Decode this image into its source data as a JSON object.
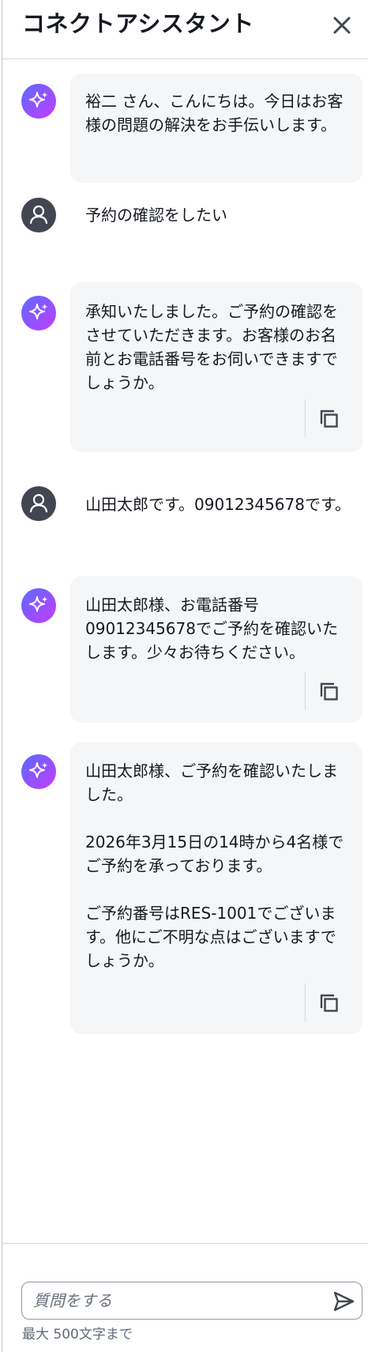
{
  "header": {
    "title": "コネクトアシスタント"
  },
  "messages": [
    {
      "role": "assistant",
      "text": "裕二 さん、こんにちは。今日はお客様の問題の解決をお手伝いします。",
      "copy": false
    },
    {
      "role": "user",
      "text": "予約の確認をしたい"
    },
    {
      "role": "assistant",
      "text": "承知いたしました。ご予約の確認をさせていただきます。お客様のお名前とお電話番号をお伺いできますでしょうか。",
      "copy": true
    },
    {
      "role": "user",
      "text": "山田太郎です。09012345678です。"
    },
    {
      "role": "assistant",
      "text": "山田太郎様、お電話番号09012345678でご予約を確認いたします。少々お待ちください。",
      "copy": true
    },
    {
      "role": "assistant",
      "text": "山田太郎様、ご予約を確認いたしました。\n\n2026年3月15日の14時から4名様でご予約を承っております。\n\nご予約番号はRES-1001でございます。他にご不明な点はございますでしょうか。",
      "copy": true
    }
  ],
  "composer": {
    "placeholder": "質問をする",
    "limit_text": "最大 500文字まで"
  },
  "colors": {
    "assistant_gradient_start": "#6b5cff",
    "assistant_gradient_end": "#c43bff",
    "user_avatar": "#414750",
    "bubble_bg": "#f5f6f8"
  }
}
